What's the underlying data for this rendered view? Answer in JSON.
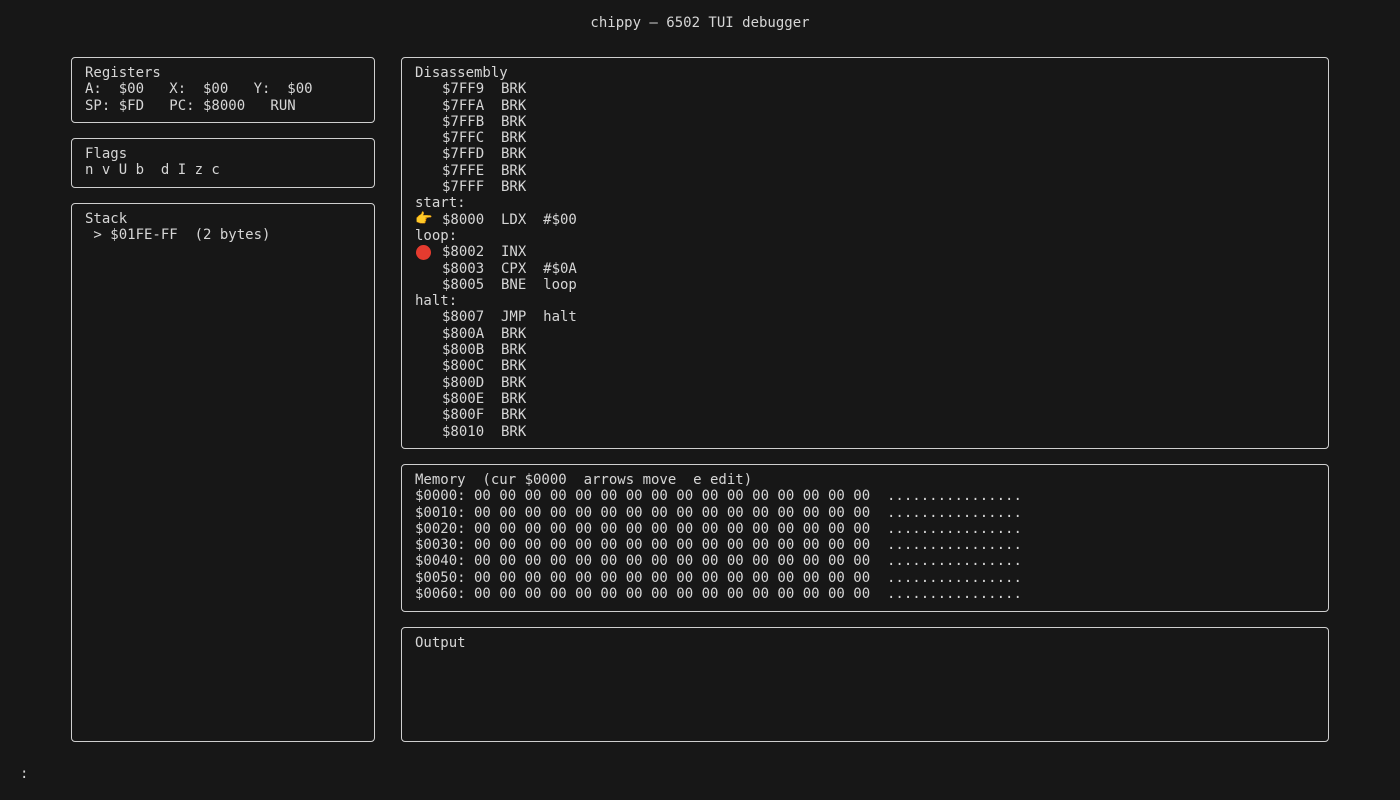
{
  "title": "chippy — 6502 TUI debugger",
  "registers": {
    "title": "Registers",
    "line1": "A:  $00   X:  $00   Y:  $00",
    "line2": "SP: $FD   PC: $8000   RUN"
  },
  "flags": {
    "title": "Flags",
    "line": "n v U b  d I z c"
  },
  "stack": {
    "title": "Stack",
    "line": " > $01FE-FF  (2 bytes)"
  },
  "disassembly": {
    "title": "Disassembly",
    "rows": [
      {
        "kind": "instr",
        "marker": "",
        "text": "$7FF9  BRK"
      },
      {
        "kind": "instr",
        "marker": "",
        "text": "$7FFA  BRK"
      },
      {
        "kind": "instr",
        "marker": "",
        "text": "$7FFB  BRK"
      },
      {
        "kind": "instr",
        "marker": "",
        "text": "$7FFC  BRK"
      },
      {
        "kind": "instr",
        "marker": "",
        "text": "$7FFD  BRK"
      },
      {
        "kind": "instr",
        "marker": "",
        "text": "$7FFE  BRK"
      },
      {
        "kind": "instr",
        "marker": "",
        "text": "$7FFF  BRK"
      },
      {
        "kind": "label",
        "marker": "",
        "text": "start:"
      },
      {
        "kind": "instr",
        "marker": "pc",
        "text": "$8000  LDX  #$00"
      },
      {
        "kind": "label",
        "marker": "",
        "text": "loop:"
      },
      {
        "kind": "instr",
        "marker": "bp",
        "text": "$8002  INX"
      },
      {
        "kind": "instr",
        "marker": "",
        "text": "$8003  CPX  #$0A"
      },
      {
        "kind": "instr",
        "marker": "",
        "text": "$8005  BNE  loop"
      },
      {
        "kind": "label",
        "marker": "",
        "text": "halt:"
      },
      {
        "kind": "instr",
        "marker": "",
        "text": "$8007  JMP  halt"
      },
      {
        "kind": "instr",
        "marker": "",
        "text": "$800A  BRK"
      },
      {
        "kind": "instr",
        "marker": "",
        "text": "$800B  BRK"
      },
      {
        "kind": "instr",
        "marker": "",
        "text": "$800C  BRK"
      },
      {
        "kind": "instr",
        "marker": "",
        "text": "$800D  BRK"
      },
      {
        "kind": "instr",
        "marker": "",
        "text": "$800E  BRK"
      },
      {
        "kind": "instr",
        "marker": "",
        "text": "$800F  BRK"
      },
      {
        "kind": "instr",
        "marker": "",
        "text": "$8010  BRK"
      }
    ]
  },
  "memory": {
    "title": "Memory  (cur $0000  arrows move  e edit)",
    "rows": [
      "$0000: 00 00 00 00 00 00 00 00 00 00 00 00 00 00 00 00  ................",
      "$0010: 00 00 00 00 00 00 00 00 00 00 00 00 00 00 00 00  ................",
      "$0020: 00 00 00 00 00 00 00 00 00 00 00 00 00 00 00 00  ................",
      "$0030: 00 00 00 00 00 00 00 00 00 00 00 00 00 00 00 00  ................",
      "$0040: 00 00 00 00 00 00 00 00 00 00 00 00 00 00 00 00  ................",
      "$0050: 00 00 00 00 00 00 00 00 00 00 00 00 00 00 00 00  ................",
      "$0060: 00 00 00 00 00 00 00 00 00 00 00 00 00 00 00 00  ................"
    ]
  },
  "output": {
    "title": "Output"
  },
  "prompt": ":",
  "colors": {
    "background": "#171717",
    "text": "#d6d6d6",
    "border": "#cfcfcf",
    "breakpoint": "#e53b2f",
    "pc_marker": "#f2b544"
  }
}
